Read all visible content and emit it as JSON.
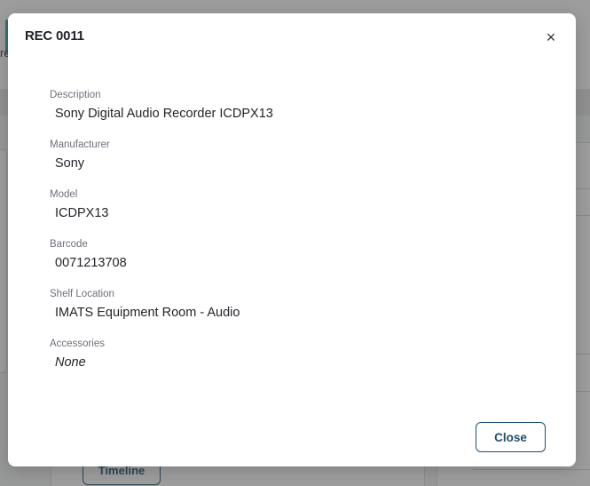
{
  "background": {
    "header_fragment": "rc",
    "timeline_button_label": "Timeline"
  },
  "modal": {
    "title": "REC 0011",
    "close_icon_glyph": "×",
    "fields": [
      {
        "label": "Description",
        "value": "Sony Digital Audio Recorder ICDPX13"
      },
      {
        "label": "Manufacturer",
        "value": "Sony"
      },
      {
        "label": "Model",
        "value": "ICDPX13"
      },
      {
        "label": "Barcode",
        "value": "0071213708"
      },
      {
        "label": "Shelf Location",
        "value": "IMATS Equipment Room - Audio"
      },
      {
        "label": "Accessories",
        "value": "None"
      }
    ],
    "close_button_label": "Close"
  },
  "colors": {
    "accent": "#3f9fbf",
    "button_border": "#1f4e6b",
    "overlay": "rgba(60,60,60,0.5)"
  }
}
